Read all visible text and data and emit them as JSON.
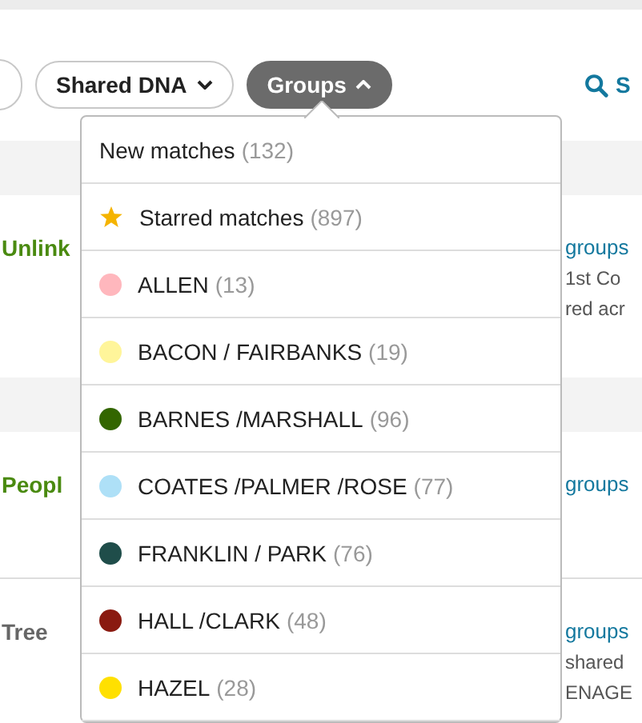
{
  "filters": [
    {
      "label": "Shared DNA",
      "expanded": false
    },
    {
      "label": "Groups",
      "expanded": true
    }
  ],
  "search": {
    "label": "S"
  },
  "rows": [
    {
      "title": "Unlink",
      "kind": "linked",
      "lines": [
        {
          "text": "groups",
          "kind": "link"
        },
        {
          "text": "1st Co",
          "kind": "text"
        },
        {
          "text": "red acr",
          "kind": "text"
        }
      ]
    },
    {
      "title": "Peopl",
      "kind": "linked",
      "lines": [
        {
          "text": "groups",
          "kind": "link"
        }
      ]
    },
    {
      "title": "Tree",
      "kind": "plain",
      "lines": [
        {
          "text": "groups",
          "kind": "link"
        },
        {
          "text": "shared",
          "kind": "text"
        },
        {
          "text": "ENAGE",
          "kind": "text"
        }
      ]
    }
  ],
  "menu": {
    "items": [
      {
        "label": "New matches",
        "count": "(132)",
        "kind": "plain"
      },
      {
        "label": "Starred matches",
        "count": "(897)",
        "kind": "starred"
      },
      {
        "label": "ALLEN",
        "count": "(13)",
        "kind": "group",
        "color": "#ffb7bd"
      },
      {
        "label": "BACON / FAIRBANKS",
        "count": "(19)",
        "kind": "group",
        "color": "#fff59a"
      },
      {
        "label": "BARNES /MARSHALL",
        "count": "(96)",
        "kind": "group",
        "color": "#336600"
      },
      {
        "label": "COATES /PALMER /ROSE",
        "count": "(77)",
        "kind": "group",
        "color": "#aee0f7"
      },
      {
        "label": "FRANKLIN / PARK",
        "count": "(76)",
        "kind": "group",
        "color": "#1f4d4a"
      },
      {
        "label": "HALL /CLARK",
        "count": "(48)",
        "kind": "group",
        "color": "#8a1a10"
      },
      {
        "label": "HAZEL",
        "count": "(28)",
        "kind": "group",
        "color": "#ffe000"
      }
    ]
  }
}
